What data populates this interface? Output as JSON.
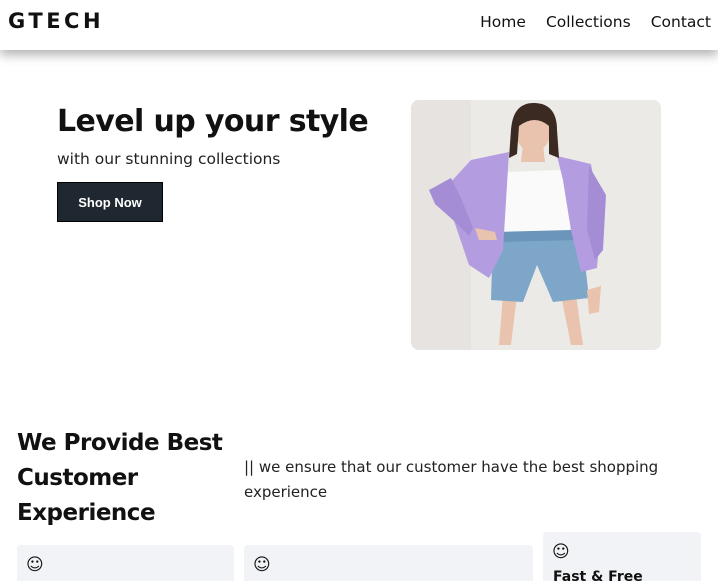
{
  "navbar": {
    "brand": "GTECH",
    "links": [
      {
        "label": "Home"
      },
      {
        "label": "Collections"
      },
      {
        "label": "Contact"
      }
    ]
  },
  "hero": {
    "title": "Level up your style",
    "subtitle": "with our stunning collections",
    "button_label": "Shop Now",
    "image_icon": "fashion-model-photo"
  },
  "section": {
    "title": "We Provide Best Customer Experience",
    "text": "|| we ensure that our customer have the best shopping experience"
  },
  "cards": [
    {
      "icon": "☺",
      "title": ""
    },
    {
      "icon": "☺",
      "title": ""
    },
    {
      "icon": "☺",
      "title": "Fast & Free"
    }
  ],
  "colors": {
    "button_bg": "#1f2731",
    "card_bg": "#f2f3f6",
    "text": "#111111"
  }
}
